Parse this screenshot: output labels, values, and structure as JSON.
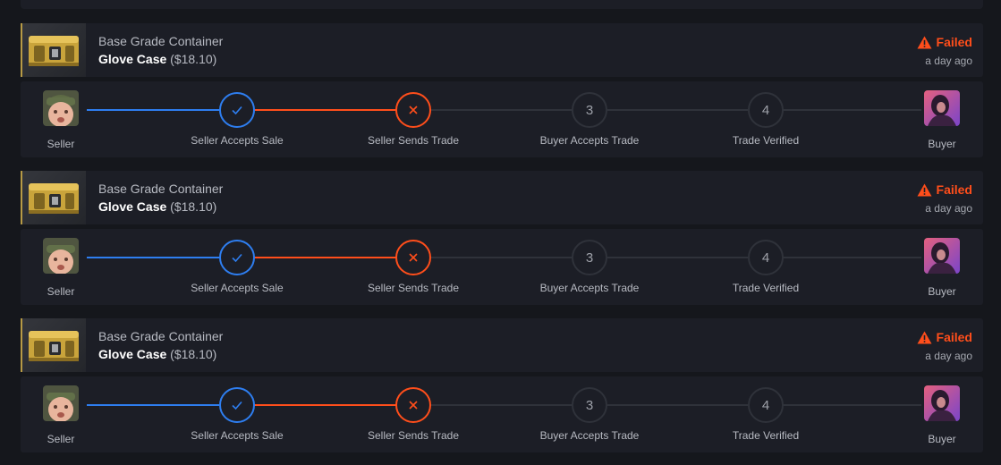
{
  "transactions": [
    {
      "item": {
        "category": "Base Grade Container",
        "name": "Glove Case",
        "price": "($18.10)"
      },
      "status": {
        "label": "Failed",
        "time": "a day ago"
      },
      "parties": {
        "seller_label": "Seller",
        "buyer_label": "Buyer"
      },
      "steps": [
        {
          "label": "Seller Accepts Sale",
          "number": "",
          "state": "done"
        },
        {
          "label": "Seller Sends Trade",
          "number": "",
          "state": "failed"
        },
        {
          "label": "Buyer Accepts Trade",
          "number": "3",
          "state": "pending"
        },
        {
          "label": "Trade Verified",
          "number": "4",
          "state": "pending"
        }
      ]
    },
    {
      "item": {
        "category": "Base Grade Container",
        "name": "Glove Case",
        "price": "($18.10)"
      },
      "status": {
        "label": "Failed",
        "time": "a day ago"
      },
      "parties": {
        "seller_label": "Seller",
        "buyer_label": "Buyer"
      },
      "steps": [
        {
          "label": "Seller Accepts Sale",
          "number": "",
          "state": "done"
        },
        {
          "label": "Seller Sends Trade",
          "number": "",
          "state": "failed"
        },
        {
          "label": "Buyer Accepts Trade",
          "number": "3",
          "state": "pending"
        },
        {
          "label": "Trade Verified",
          "number": "4",
          "state": "pending"
        }
      ]
    },
    {
      "item": {
        "category": "Base Grade Container",
        "name": "Glove Case",
        "price": "($18.10)"
      },
      "status": {
        "label": "Failed",
        "time": "a day ago"
      },
      "parties": {
        "seller_label": "Seller",
        "buyer_label": "Buyer"
      },
      "steps": [
        {
          "label": "Seller Accepts Sale",
          "number": "",
          "state": "done"
        },
        {
          "label": "Seller Sends Trade",
          "number": "",
          "state": "failed"
        },
        {
          "label": "Buyer Accepts Trade",
          "number": "3",
          "state": "pending"
        },
        {
          "label": "Trade Verified",
          "number": "4",
          "state": "pending"
        }
      ]
    }
  ],
  "icons": {
    "item": "glove-case-icon",
    "status": "warning-triangle-icon",
    "done": "check-icon",
    "failed": "x-icon"
  },
  "colors": {
    "background": "#15171c",
    "panel": "#1c1e26",
    "accent_blue": "#2e7ef0",
    "failed_orange": "#ff4e1b",
    "pending_gray": "#2f323a"
  }
}
